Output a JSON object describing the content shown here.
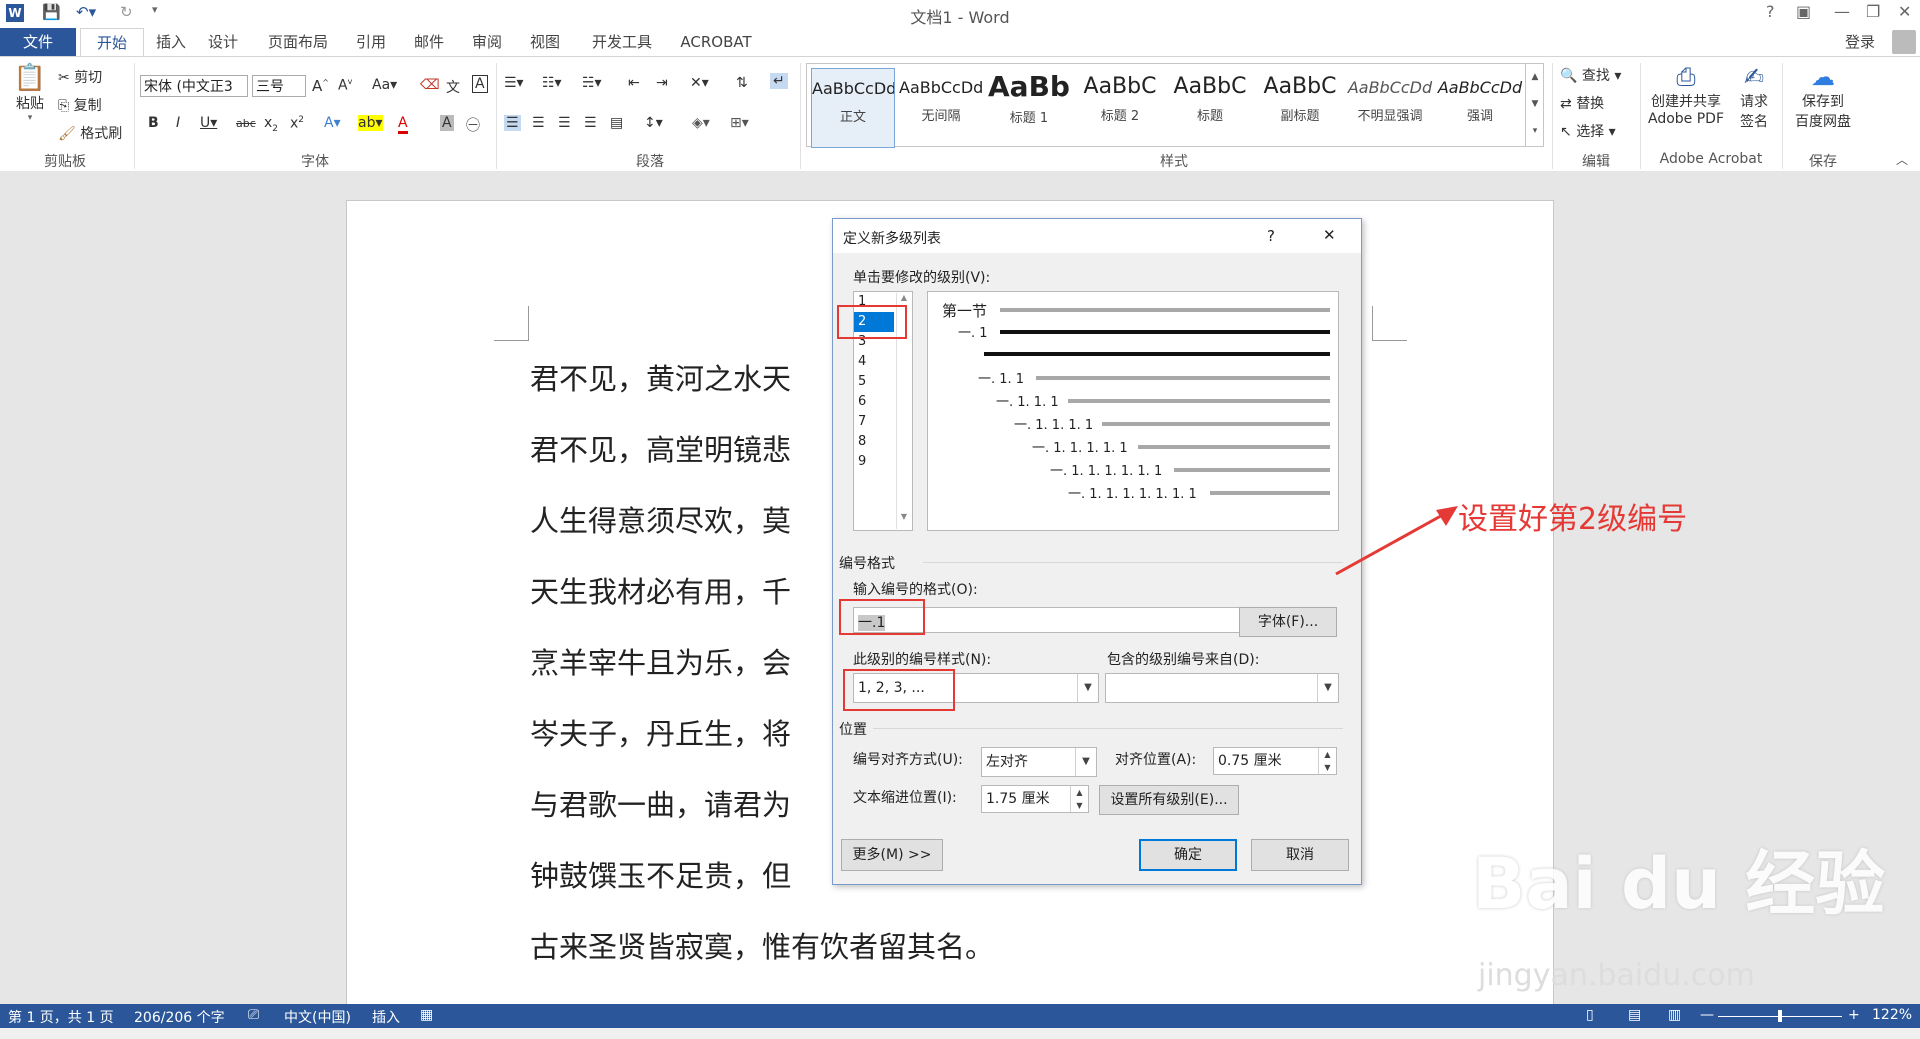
{
  "app": {
    "title": "文档1 - Word",
    "login": "登录",
    "help": "?"
  },
  "tabs": [
    "文件",
    "开始",
    "插入",
    "设计",
    "页面布局",
    "引用",
    "邮件",
    "审阅",
    "视图",
    "开发工具",
    "ACROBAT"
  ],
  "ribbon": {
    "clipboard": {
      "paste": "粘贴",
      "cut": "剪切",
      "copy": "复制",
      "format_painter": "格式刷",
      "label": "剪贴板"
    },
    "font": {
      "name": "宋体 (中文正3",
      "size": "三号",
      "label": "字体"
    },
    "paragraph": {
      "label": "段落"
    },
    "styles": {
      "label": "样式",
      "items": [
        {
          "sample": "AaBbCcDd",
          "name": "正文"
        },
        {
          "sample": "AaBbCcDd",
          "name": "无间隔"
        },
        {
          "sample": "AaBb",
          "name": "标题 1"
        },
        {
          "sample": "AaBbC",
          "name": "标题 2"
        },
        {
          "sample": "AaBbC",
          "name": "标题"
        },
        {
          "sample": "AaBbC",
          "name": "副标题"
        },
        {
          "sample": "AaBbCcDd",
          "name": "不明显强调"
        },
        {
          "sample": "AaBbCcDd",
          "name": "强调"
        }
      ]
    },
    "editing": {
      "find": "查找",
      "replace": "替换",
      "select": "选择",
      "label": "编辑"
    },
    "acrobat": {
      "create_share_1": "创建并共享",
      "create_share_2": "Adobe PDF",
      "request_sign_1": "请求",
      "request_sign_2": "签名",
      "label": "Adobe Acrobat"
    },
    "save": {
      "save_1": "保存到",
      "save_2": "百度网盘",
      "label": "保存"
    }
  },
  "document": {
    "lines": [
      "君不见，黄河之水天",
      "君不见，高堂明镜悲",
      "人生得意须尽欢，莫",
      "天生我材必有用，千",
      "烹羊宰牛且为乐，会",
      "岑夫子，丹丘生，将",
      "与君歌一曲，请君为",
      "钟鼓馔玉不足贵，但",
      "古来圣贤皆寂寞，惟有饮者留其名。"
    ]
  },
  "dialog": {
    "title": "定义新多级列表",
    "help": "?",
    "close": "✕",
    "level_label": "单击要修改的级别(V):",
    "levels": [
      "1",
      "2",
      "3",
      "4",
      "5",
      "6",
      "7",
      "8",
      "9"
    ],
    "selected_level": "2",
    "preview": {
      "heading": "第一节",
      "rows": [
        "一. 1",
        "",
        "一. 1. 1",
        "一. 1. 1. 1",
        "一. 1. 1. 1. 1",
        "一. 1. 1. 1. 1. 1",
        "一. 1. 1. 1. 1. 1. 1",
        "一. 1. 1. 1. 1. 1. 1. 1"
      ]
    },
    "number_format_section": "编号格式",
    "enter_format_label": "输入编号的格式(O):",
    "enter_format_value": "一.1",
    "font_button": "字体(F)...",
    "number_style_label": "此级别的编号样式(N):",
    "number_style_value": "1, 2, 3, ...",
    "include_level_label": "包含的级别编号来自(D):",
    "include_level_value": "",
    "position_section": "位置",
    "alignment_label": "编号对齐方式(U):",
    "alignment_value": "左对齐",
    "align_at_label": "对齐位置(A):",
    "align_at_value": "0.75 厘米",
    "indent_label": "文本缩进位置(I):",
    "indent_value": "1.75 厘米",
    "set_all_levels": "设置所有级别(E)...",
    "more_button": "更多(M) >>",
    "ok_button": "确定",
    "cancel_button": "取消"
  },
  "annotation": "设置好第2级编号",
  "statusbar": {
    "page": "第 1 页，共 1 页",
    "words": "206/206 个字",
    "language": "中文(中国)",
    "mode": "插入",
    "zoom": "122%"
  },
  "watermark": {
    "main": "Bai du 经验",
    "sub": "jingyan.baidu.com"
  },
  "colors": {
    "accent": "#2b579a",
    "annotation": "#e53935"
  }
}
